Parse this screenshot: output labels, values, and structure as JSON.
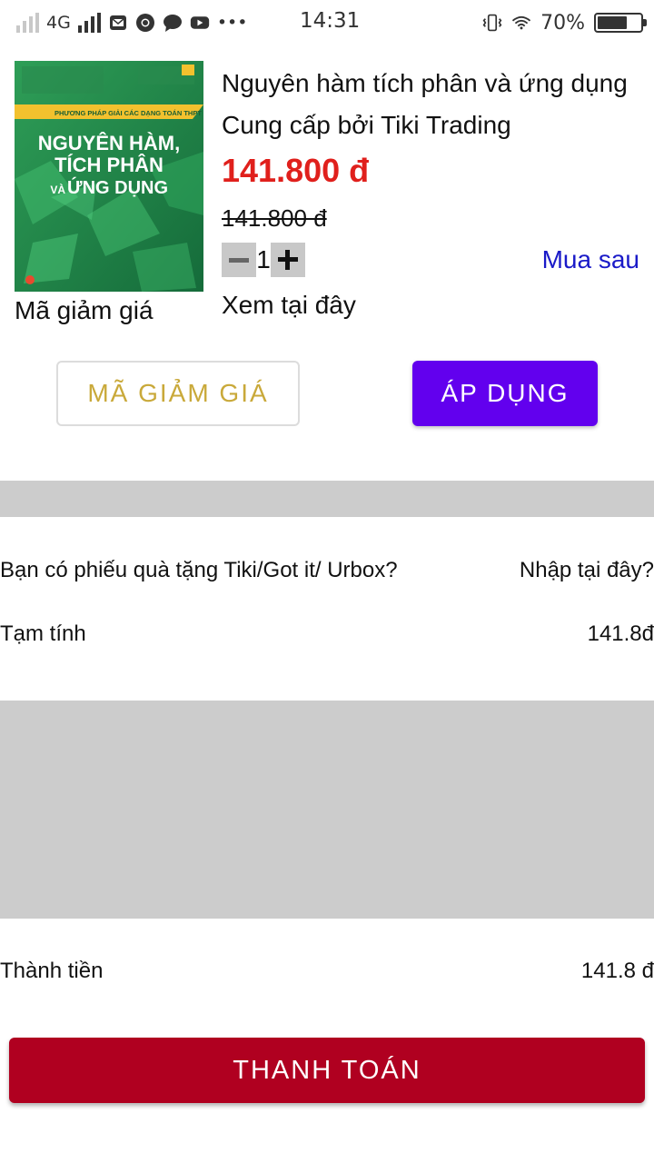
{
  "status_bar": {
    "network": "4G",
    "time": "14:31",
    "battery": "70%",
    "battery_level": 0.7,
    "more": "•••"
  },
  "product": {
    "title": "Nguyên hàm tích phân và ứng dụng",
    "seller": "Cung cấp bởi Tiki Trading",
    "price": "141.800 đ",
    "old_price": "141.800 đ",
    "quantity": "1",
    "buy_later": "Mua sau",
    "view_here": "Xem tại đây",
    "coupon_label": "Mã giảm giá",
    "cover": {
      "banner": "PHƯƠNG PHÁP GIẢI CÁC DẠNG TOÁN THPT",
      "line1": "NGUYÊN HÀM,",
      "line2": "TÍCH PHÂN",
      "line3_small": "VÀ",
      "line3": "ỨNG DỤNG",
      "color": "#1f8a4c"
    }
  },
  "coupon": {
    "input_button": "MÃ GIẢM GIÁ",
    "apply_button": "ÁP DỤNG"
  },
  "gift": {
    "question": "Bạn có phiếu quà tặng Tiki/Got it/ Urbox?",
    "link": "Nhập tại đây?"
  },
  "subtotal": {
    "label": "Tạm tính",
    "value": "141.8đ"
  },
  "total": {
    "label": "Thành tiền",
    "value": "141.8 đ"
  },
  "checkout_button": "THANH TOÁN",
  "colors": {
    "price": "#e0201c",
    "apply": "#6200ee",
    "checkout": "#b00020",
    "link": "#1a1ac8",
    "coupon_text": "#c9a93a",
    "divider": "#cccccc"
  }
}
